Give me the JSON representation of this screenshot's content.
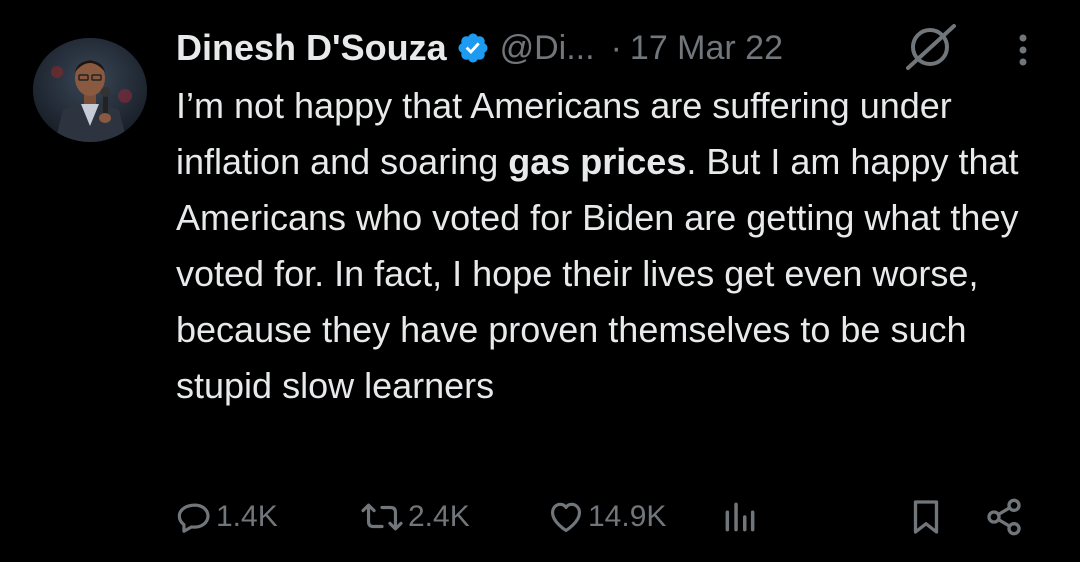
{
  "author": {
    "display_name": "Dinesh D'Souza",
    "handle": "@Di...",
    "verified": true,
    "avatar_icon": "profile-photo"
  },
  "meta": {
    "separator": "·",
    "date": "17 Mar 22"
  },
  "tweet": {
    "text_before": "I’m not happy that Americans are suffering under inflation and soaring ",
    "text_bold": "gas prices",
    "text_after": ". But I am happy that Americans who voted for Biden are getting what they voted for. In fact, I hope their lives get even worse, because they have proven themselves to be such stupid slow learners"
  },
  "actions": {
    "replies": "1.4K",
    "reposts": "2.4K",
    "likes": "14.9K"
  },
  "icons": {
    "verified": "verified-badge-icon",
    "grok": "grok-icon",
    "more": "more-icon",
    "reply": "reply-icon",
    "repost": "repost-icon",
    "like": "heart-icon",
    "views": "views-icon",
    "bookmark": "bookmark-icon",
    "share": "share-icon"
  },
  "colors": {
    "background": "#000000",
    "text": "#e7e9ea",
    "muted": "#71767b",
    "verified": "#1d9bf0"
  }
}
